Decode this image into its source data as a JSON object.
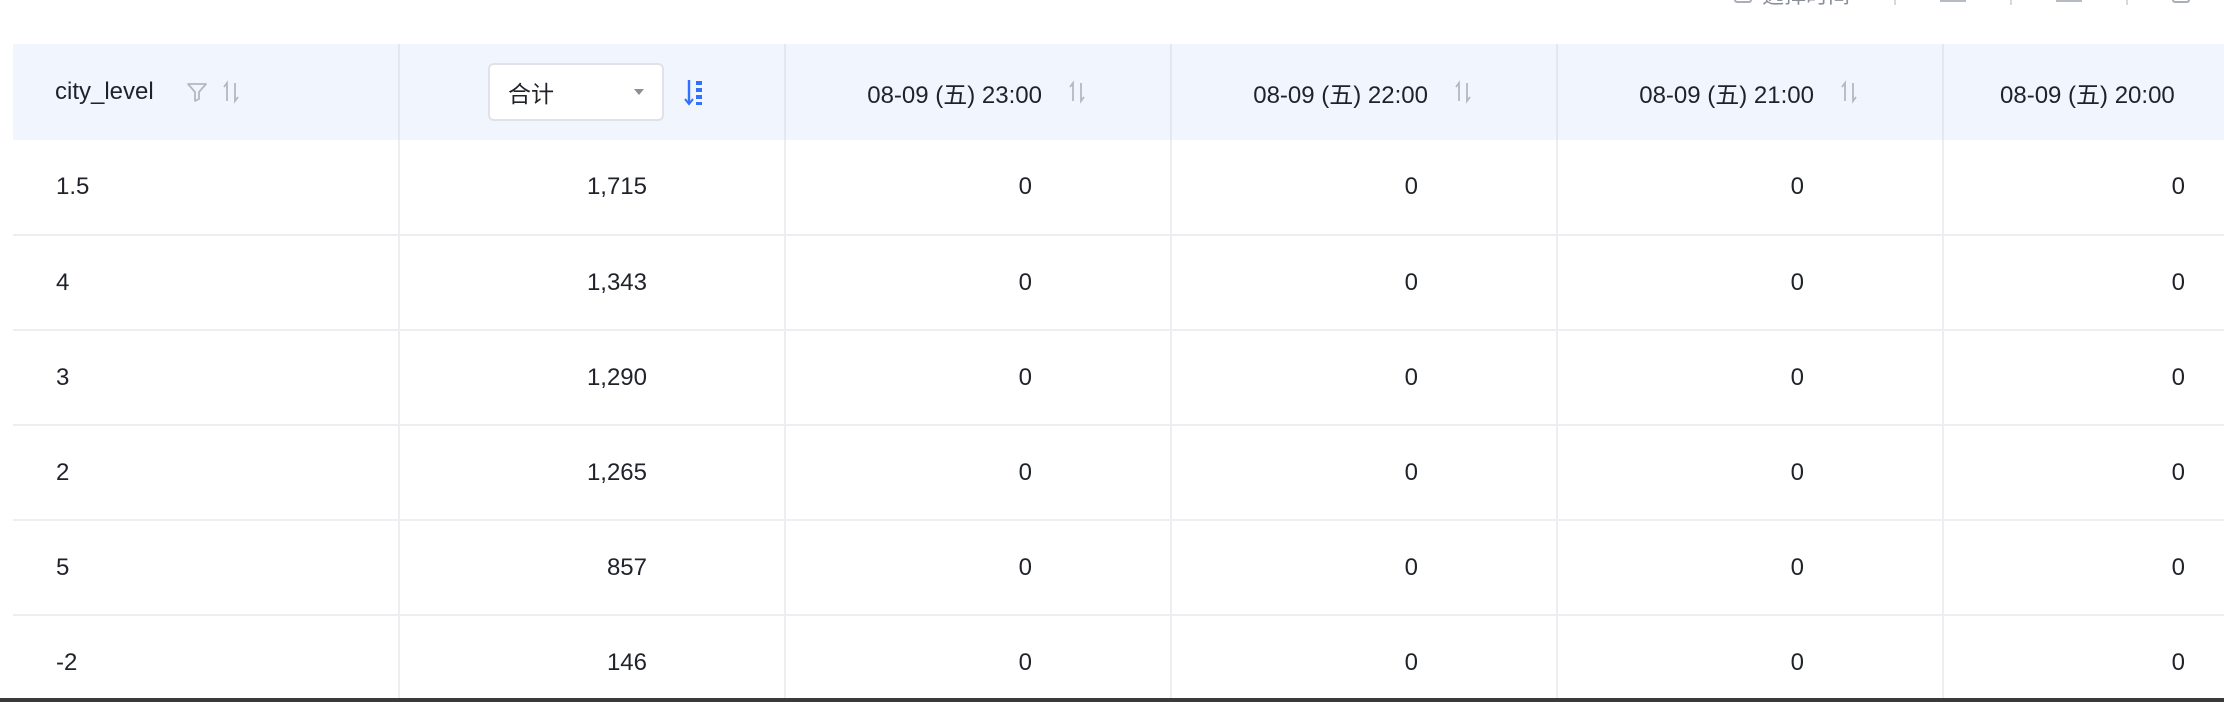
{
  "toolbar": {
    "items": [
      {
        "label": "选择时间"
      },
      {
        "label": ""
      },
      {
        "label": ""
      },
      {
        "label": ""
      }
    ]
  },
  "table": {
    "dimension_header": "city_level",
    "aggregate_select": {
      "value": "合计"
    },
    "time_columns": [
      "08-09 (五) 23:00",
      "08-09 (五) 22:00",
      "08-09 (五) 21:00",
      "08-09 (五) 20:00"
    ],
    "rows": [
      {
        "city_level": "1.5",
        "total": "1,715",
        "values": [
          "0",
          "0",
          "0",
          "0"
        ]
      },
      {
        "city_level": "4",
        "total": "1,343",
        "values": [
          "0",
          "0",
          "0",
          "0"
        ]
      },
      {
        "city_level": "3",
        "total": "1,290",
        "values": [
          "0",
          "0",
          "0",
          "0"
        ]
      },
      {
        "city_level": "2",
        "total": "1,265",
        "values": [
          "0",
          "0",
          "0",
          "0"
        ]
      },
      {
        "city_level": "5",
        "total": "857",
        "values": [
          "0",
          "0",
          "0",
          "0"
        ]
      },
      {
        "city_level": "-2",
        "total": "146",
        "values": [
          "0",
          "0",
          "0",
          "0"
        ]
      }
    ]
  },
  "colors": {
    "header_bg": "#f1f5fd",
    "accent": "#3370ff",
    "icon_gray": "#b3b8c2",
    "border": "#eceef2"
  }
}
